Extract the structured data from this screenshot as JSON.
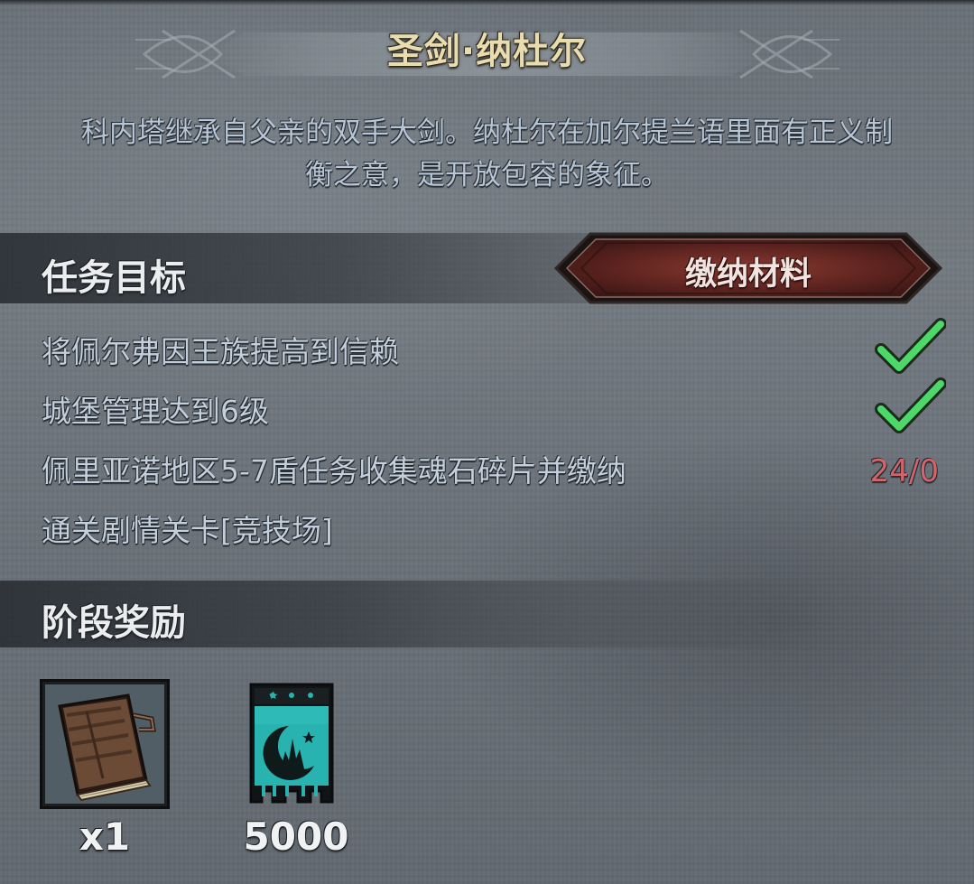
{
  "title": "圣剑·纳杜尔",
  "description": {
    "line1": "科内塔继承自父亲的双手大剑。纳杜尔在加尔提兰语里面有正义制",
    "line2": "衡之意，是开放包容的象征。"
  },
  "objectives_section": {
    "title": "任务目标",
    "submit_label": "缴纳材料",
    "items": [
      {
        "text": "将佩尔弗因王族提高到信赖",
        "completed": true
      },
      {
        "text": "城堡管理达到6级",
        "completed": true
      },
      {
        "text": "佩里亚诺地区5-7盾任务收集魂石碎片并缴纳",
        "progress": "24/0"
      },
      {
        "text": "通关剧情关卡[竞技场]"
      }
    ]
  },
  "rewards_section": {
    "title": "阶段奖励",
    "items": [
      {
        "icon": "book-icon",
        "quantity": "x1"
      },
      {
        "icon": "moon-banner-icon",
        "quantity": "5000"
      }
    ]
  },
  "colors": {
    "title": "#e9dcae",
    "description": "#b7c6d6",
    "objective_text": "#c3cfdc",
    "progress": "#d2646c",
    "check": "#4fd86a",
    "button": "#6a2a25",
    "banner_teal": "#29b3b0"
  }
}
